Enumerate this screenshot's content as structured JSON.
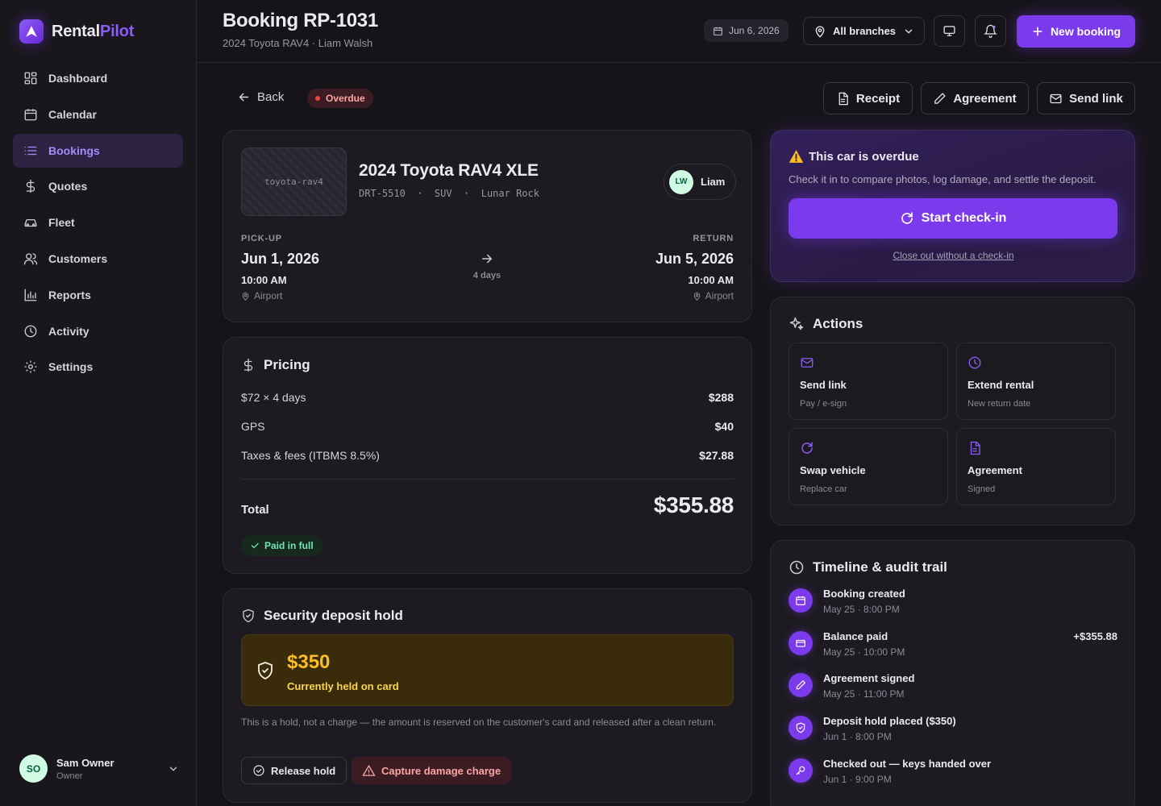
{
  "brand": {
    "name_main": "Rental",
    "name_accent": "Pilot",
    "icon": "rentalpilot-logo-icon"
  },
  "sidebar": {
    "items": [
      {
        "label": "Dashboard",
        "icon": "dashboard-grid-icon",
        "active": false
      },
      {
        "label": "Calendar",
        "icon": "calendar-icon",
        "active": false
      },
      {
        "label": "Bookings",
        "icon": "list-icon",
        "active": true
      },
      {
        "label": "Quotes",
        "icon": "dollar-icon",
        "active": false
      },
      {
        "label": "Fleet",
        "icon": "car-icon",
        "active": false
      },
      {
        "label": "Customers",
        "icon": "users-icon",
        "active": false
      },
      {
        "label": "Reports",
        "icon": "bar-chart-icon",
        "active": false
      },
      {
        "label": "Activity",
        "icon": "clock-icon",
        "active": false
      },
      {
        "label": "Settings",
        "icon": "gear-icon",
        "active": false
      }
    ],
    "user": {
      "initials": "SO",
      "name": "Sam Owner",
      "role": "Owner"
    }
  },
  "header": {
    "title": "Booking RP-1031",
    "subtitle": "2024 Toyota RAV4 · Liam Walsh",
    "date": "Jun 6, 2026",
    "branch": "All branches",
    "new_booking": "New booking"
  },
  "toolbar": {
    "back": "Back",
    "status": "Overdue",
    "receipt": "Receipt",
    "agreement": "Agreement",
    "send_link": "Send link"
  },
  "vehicle": {
    "thumb_label": "toyota-rav4",
    "name": "2024 Toyota RAV4 XLE",
    "meta": "DRT-5510  ·  SUV  ·  Lunar Rock",
    "customer_initials": "LW",
    "customer_name": "Liam",
    "pickup": {
      "label": "PICK-UP",
      "date": "Jun 1, 2026",
      "time": "10:00 AM",
      "location": "Airport"
    },
    "return": {
      "label": "RETURN",
      "date": "Jun 5, 2026",
      "time": "10:00 AM",
      "location": "Airport"
    },
    "duration": "4 days"
  },
  "pricing": {
    "title": "Pricing",
    "rows": [
      {
        "label": "$72 × 4 days",
        "amount": "$288"
      },
      {
        "label": "GPS",
        "amount": "$40"
      },
      {
        "label": "Taxes & fees (ITBMS 8.5%)",
        "amount": "$27.88"
      }
    ],
    "total_label": "Total",
    "total": "$355.88",
    "paid": "Paid in full"
  },
  "deposit": {
    "title": "Security deposit hold",
    "amount": "$350",
    "status": "Currently held on card",
    "note": "This is a hold, not a charge — the amount is reserved on the customer's card and released after a clean return.",
    "release": "Release hold",
    "capture": "Capture damage charge"
  },
  "overdue": {
    "title": "This car is overdue",
    "text": "Check it in to compare photos, log damage, and settle the deposit.",
    "button": "Start check-in",
    "link": "Close out without a check-in"
  },
  "actions": {
    "title": "Actions",
    "items": [
      {
        "name": "Send link",
        "sub": "Pay / e-sign",
        "icon": "mail-icon"
      },
      {
        "name": "Extend rental",
        "sub": "New return date",
        "icon": "clock-icon"
      },
      {
        "name": "Swap vehicle",
        "sub": "Replace car",
        "icon": "refresh-icon"
      },
      {
        "name": "Agreement",
        "sub": "Signed",
        "icon": "document-icon"
      }
    ]
  },
  "timeline": {
    "title": "Timeline & audit trail",
    "items": [
      {
        "title": "Booking created",
        "time": "May 25 · 8:00 PM",
        "amount": "",
        "icon": "calendar-icon"
      },
      {
        "title": "Balance paid",
        "time": "May 25 · 10:00 PM",
        "amount": "+$355.88",
        "icon": "credit-card-icon"
      },
      {
        "title": "Agreement signed",
        "time": "May 25 · 11:00 PM",
        "amount": "",
        "icon": "pen-icon"
      },
      {
        "title": "Deposit hold placed ($350)",
        "time": "Jun 1 · 8:00 PM",
        "amount": "",
        "icon": "shield-icon"
      },
      {
        "title": "Checked out — keys handed over",
        "time": "Jun 1 · 9:00 PM",
        "amount": "",
        "icon": "key-icon"
      }
    ]
  },
  "colors": {
    "accent": "#7c3aed",
    "accent_light": "#a78bfa",
    "danger": "#ef4444",
    "success": "#6ee7b7",
    "warning": "#fbbf24",
    "background": "#161419",
    "card": "#1d1b21"
  }
}
